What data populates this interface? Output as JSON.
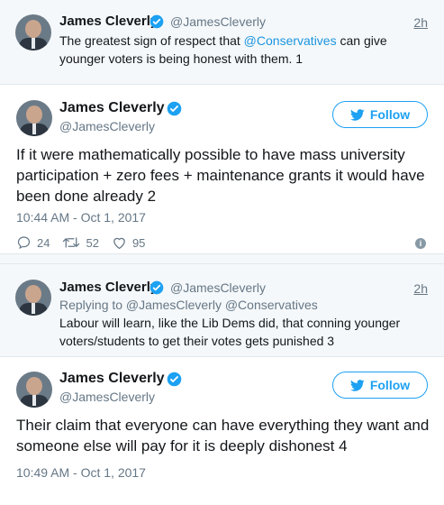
{
  "tweets": [
    {
      "name": "James Cleverly",
      "handle": "@JamesCleverly",
      "time": "2h",
      "text_before": "The greatest sign of respect that ",
      "mention": "@Conservatives",
      "text_after": " can give younger voters is being honest with them. 1"
    },
    {
      "name": "James Cleverly",
      "handle": "@JamesCleverly",
      "follow_label": "Follow",
      "text": "If it were mathematically possible to have mass university participation + zero fees + maintenance grants it would have been done already 2",
      "date": "10:44 AM - Oct 1, 2017",
      "replies": "24",
      "retweets": "52",
      "likes": "95"
    },
    {
      "name": "James Cleverly",
      "handle": "@JamesCleverly",
      "time": "2h",
      "replying_to": "Replying to @JamesCleverly @Conservatives",
      "text": "Labour will learn, like the Lib Dems did, that conning younger voters/students to get their votes gets punished 3"
    },
    {
      "name": "James Cleverly",
      "handle": "@JamesCleverly",
      "follow_label": "Follow",
      "text": "Their claim that everyone can have everything they want and someone else will pay for it is deeply dishonest 4",
      "date": "10:49 AM - Oct 1, 2017"
    }
  ],
  "colors": {
    "accent": "#1da1f2",
    "muted": "#657786",
    "bg_compact": "#f5f8fa"
  },
  "icons": [
    "verified-badge-icon",
    "twitter-bird-icon",
    "reply-icon",
    "retweet-icon",
    "like-icon",
    "info-icon"
  ]
}
